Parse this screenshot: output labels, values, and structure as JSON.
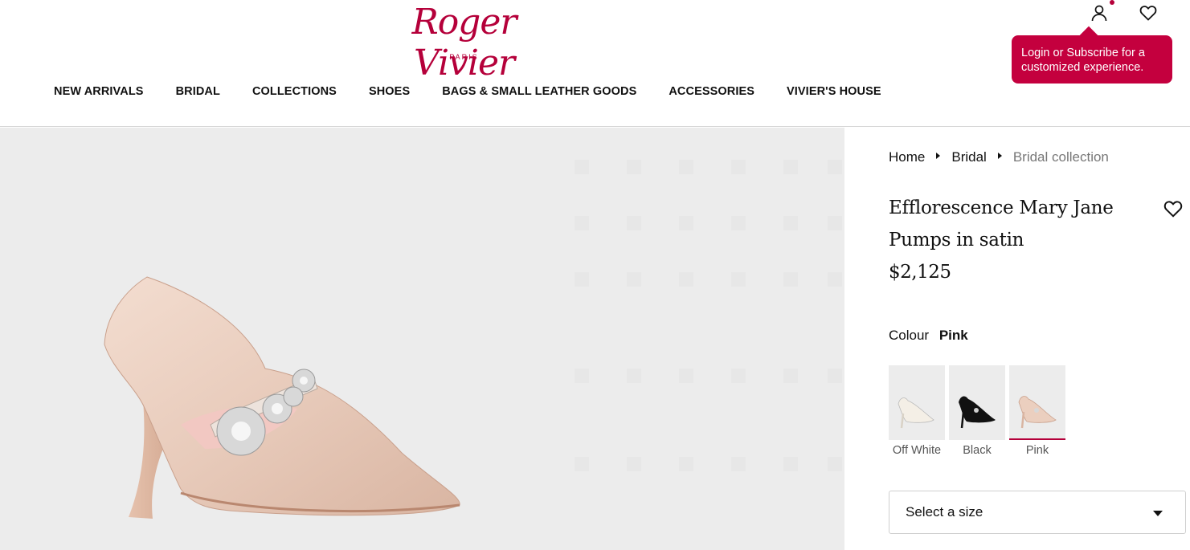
{
  "brand": {
    "name": "Roger Vivier",
    "sub": "PARIS"
  },
  "nav": [
    "NEW ARRIVALS",
    "BRIDAL",
    "COLLECTIONS",
    "SHOES",
    "BAGS & SMALL LEATHER GOODS",
    "ACCESSORIES",
    "VIVIER'S HOUSE"
  ],
  "header_icons": {
    "account": "account-icon",
    "wishlist": "heart-icon"
  },
  "tooltip": {
    "text": "Login or Subscribe for a customized experience."
  },
  "breadcrumb": [
    "Home",
    "Bridal",
    "Bridal collection"
  ],
  "product": {
    "title": "Efflorescence Mary Jane Pumps in satin",
    "price": "$2,125",
    "colour_label": "Colour",
    "colour_value": "Pink",
    "swatches": [
      {
        "name": "Off White",
        "color": "#f3eee6",
        "selected": false
      },
      {
        "name": "Black",
        "color": "#111111",
        "selected": false
      },
      {
        "name": "Pink",
        "color": "#e9cfc0",
        "selected": true
      }
    ],
    "size_placeholder": "Select a size"
  },
  "colors": {
    "accent": "#b5003a",
    "tooltip_bg": "#c4003e",
    "image_bg": "#ececec"
  }
}
